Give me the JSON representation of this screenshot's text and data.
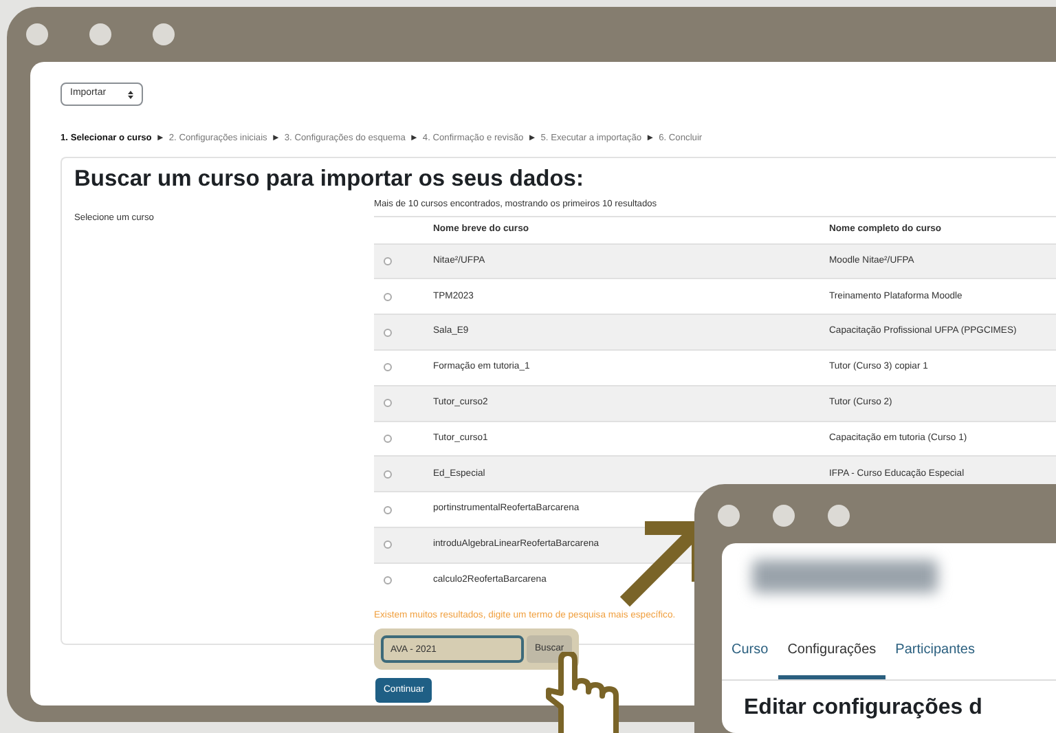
{
  "main_window": {
    "select": {
      "value": "Importar"
    },
    "steps": [
      {
        "label": "1. Selecionar o curso",
        "selected": true
      },
      {
        "label": "2. Configurações iniciais",
        "selected": false
      },
      {
        "label": "3. Configurações do esquema",
        "selected": false
      },
      {
        "label": "4. Confirmação e revisão",
        "selected": false
      },
      {
        "label": "5. Executar a importação",
        "selected": false
      },
      {
        "label": "6. Concluir",
        "selected": false
      }
    ],
    "step_separator": "►",
    "heading": "Buscar um curso para importar os seus dados:",
    "side_label": "Selecione um curso",
    "results_note": "Mais de 10 cursos encontrados, mostrando os primeiros 10 resultados",
    "table": {
      "columns": [
        "Nome breve do curso",
        "Nome completo do curso"
      ],
      "rows": [
        {
          "selected": false,
          "short_name": "Nitae²/UFPA",
          "full_name": "Moodle Nitae²/UFPA"
        },
        {
          "selected": false,
          "short_name": "TPM2023",
          "full_name": "Treinamento Plataforma Moodle"
        },
        {
          "selected": false,
          "short_name": "Sala_E9",
          "full_name": "Capacitação Profissional UFPA (PPGCIMES)"
        },
        {
          "selected": false,
          "short_name": "Formação em tutoria_1",
          "full_name": "Tutor (Curso 3) copiar 1"
        },
        {
          "selected": false,
          "short_name": "Tutor_curso2",
          "full_name": "Tutor (Curso 2)"
        },
        {
          "selected": false,
          "short_name": "Tutor_curso1",
          "full_name": "Capacitação em tutoria (Curso 1)"
        },
        {
          "selected": false,
          "short_name": "Ed_Especial",
          "full_name": "IFPA - Curso Educação Especial"
        },
        {
          "selected": false,
          "short_name": "portinstrumentalReofertaBarcarena"
        },
        {
          "selected": false,
          "short_name": "introduAlgebraLinearReofertaBarcarena"
        },
        {
          "selected": false,
          "short_name": "calculo2ReofertaBarcarena"
        }
      ]
    },
    "warning": "Existem muitos resultados, digite um termo de pesquisa mais específico.",
    "search": {
      "value": "AVA - 2021",
      "button": "Buscar"
    },
    "continue_button": "Continuar"
  },
  "second_window": {
    "tabs": [
      {
        "label": "Curso",
        "selected": false
      },
      {
        "label": "Configurações",
        "selected": true
      },
      {
        "label": "Participantes",
        "selected": false
      }
    ],
    "heading": "Editar configurações d"
  }
}
